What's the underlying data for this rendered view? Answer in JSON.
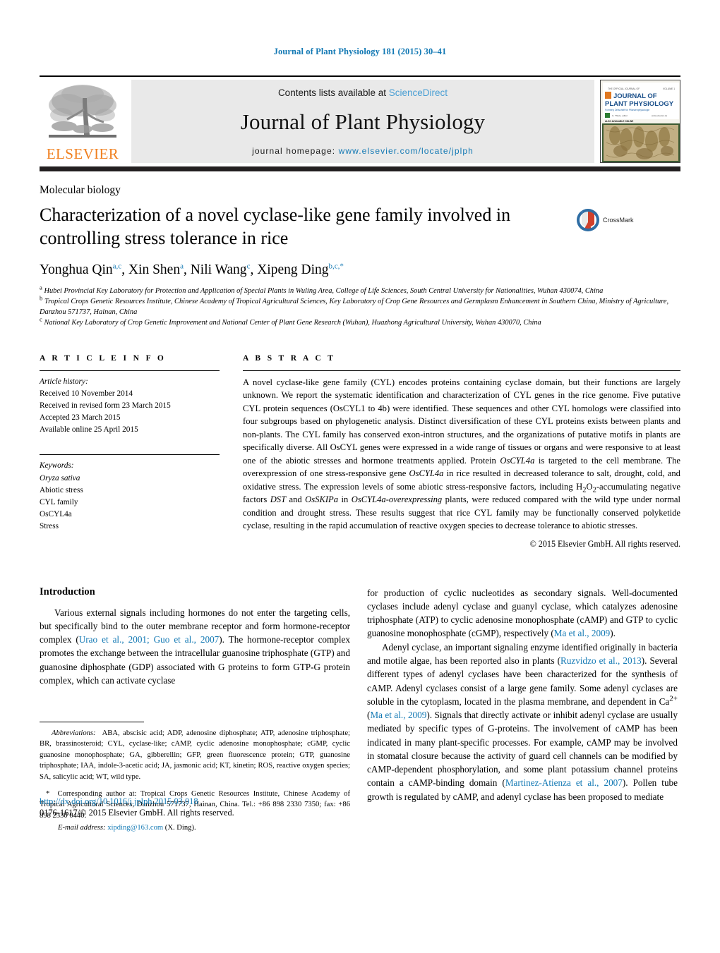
{
  "running_head": "Journal of Plant Physiology 181 (2015) 30–41",
  "masthead": {
    "publisher_name": "ELSEVIER",
    "contents_prefix": "Contents lists available at ",
    "contents_link": "ScienceDirect",
    "journal_title": "Journal of Plant Physiology",
    "homepage_prefix": "journal homepage: ",
    "homepage_url": "www.elsevier.com/locate/jplph",
    "cover": {
      "line1": "JOURNAL OF",
      "line2": "PLANT PHYSIOLOGY"
    },
    "link_color": "#1379b4",
    "sciencedirect_color": "#4a9fd4",
    "elsevier_orange": "#f08020"
  },
  "article": {
    "section_label": "Molecular biology",
    "title": "Characterization of a novel cyclase-like gene family involved in controlling stress tolerance in rice",
    "crossmark_label": "CrossMark",
    "authors_html": "Yonghua Qin<sup>a,c</sup>, Xin Shen<sup>a</sup>, Nili Wang<sup>c</sup>, Xipeng Ding<sup>b,c,</sup><sup>*</sup>",
    "affiliations": [
      "Hubei Provincial Key Laboratory for Protection and Application of Special Plants in Wuling Area, College of Life Sciences, South Central University for Nationalities, Wuhan 430074, China",
      "Tropical Crops Genetic Resources Institute, Chinese Academy of Tropical Agricultural Sciences, Key Laboratory of Crop Gene Resources and Germplasm Enhancement in Southern China, Ministry of Agriculture, Danzhou 571737, Hainan, China",
      "National Key Laboratory of Crop Genetic Improvement and National Center of Plant Gene Research (Wuhan), Huazhong Agricultural University, Wuhan 430070, China"
    ],
    "affiliation_markers": [
      "a",
      "b",
      "c"
    ]
  },
  "article_info": {
    "heading": "A R T I C L E    I N F O",
    "history_label": "Article history:",
    "history": [
      "Received 10 November 2014",
      "Received in revised form 23 March 2015",
      "Accepted 23 March 2015",
      "Available online 25 April 2015"
    ],
    "keywords_label": "Keywords:",
    "keywords": [
      "Oryza sativa",
      "Abiotic stress",
      "CYL family",
      "OsCYL4a",
      "Stress"
    ],
    "keyword_italic_flags": [
      true,
      false,
      false,
      false,
      false
    ]
  },
  "abstract": {
    "heading": "A B S T R A C T",
    "text": "A novel cyclase-like gene family (CYL) encodes proteins containing cyclase domain, but their functions are largely unknown. We report the systematic identification and characterization of CYL genes in the rice genome. Five putative CYL protein sequences (OsCYL1 to 4b) were identified. These sequences and other CYL homologs were classified into four subgroups based on phylogenetic analysis. Distinct diversification of these CYL proteins exists between plants and non-plants. The CYL family has conserved exon-intron structures, and the organizations of putative motifs in plants are specifically diverse. All OsCYL genes were expressed in a wide range of tissues or organs and were responsive to at least one of the abiotic stresses and hormone treatments applied. Protein OsCYL4a is targeted to the cell membrane. The overexpression of one stress-responsive gene OsCYL4a in rice resulted in decreased tolerance to salt, drought, cold, and oxidative stress. The expression levels of some abiotic stress-responsive factors, including H2O2-accumulating negative factors DST and OsSKIPa in OsCYL4a-overexpressing plants, were reduced compared with the wild type under normal condition and drought stress. These results suggest that rice CYL family may be functionally conserved polyketide cyclase, resulting in the rapid accumulation of reactive oxygen species to decrease tolerance to abiotic stresses.",
    "copyright": "© 2015 Elsevier GmbH. All rights reserved."
  },
  "body": {
    "intro_heading": "Introduction",
    "left_paragraph_1_pre": "Various external signals including hormones do not enter the targeting cells, but specifically bind to the outer membrane receptor and form hormone-receptor complex (",
    "left_paragraph_1_ref": "Urao et al., 2001; Guo et al., 2007",
    "left_paragraph_1_post": "). The hormone-receptor complex promotes the exchange between the intracellular guanosine triphosphate (GTP) and guanosine diphosphate (GDP) associated with G proteins to form GTP-G protein complex, which can activate cyclase",
    "right_paragraph_1_pre": "for production of cyclic nucleotides as secondary signals. Well-documented cyclases include adenyl cyclase and guanyl cyclase, which catalyzes adenosine triphosphate (ATP) to cyclic adenosine monophosphate (cAMP) and GTP to cyclic guanosine monophosphate (cGMP), respectively (",
    "right_paragraph_1_ref": "Ma et al., 2009",
    "right_paragraph_1_post": ").",
    "right_paragraph_2_seg1": "Adenyl cyclase, an important signaling enzyme identified originally in bacteria and motile algae, has been reported also in plants (",
    "right_paragraph_2_ref1": "Ruzvidzo et al., 2013",
    "right_paragraph_2_seg2": "). Several different types of adenyl cyclases have been characterized for the synthesis of cAMP. Adenyl cyclases consist of a large gene family. Some adenyl cyclases are soluble in the cytoplasm, located in the plasma membrane, and dependent in Ca2+ (",
    "right_paragraph_2_ref2": "Ma et al., 2009",
    "right_paragraph_2_seg3": "). Signals that directly activate or inhibit adenyl cyclase are usually mediated by specific types of G-proteins. The involvement of cAMP has been indicated in many plant-specific processes. For example, cAMP may be involved in stomatal closure because the activity of guard cell channels can be modified by cAMP-dependent phosphorylation, and some plant potassium channel proteins contain a cAMP-binding domain (",
    "right_paragraph_2_ref3": "Martinez-Atienza et al., 2007",
    "right_paragraph_2_seg4": "). Pollen tube growth is regulated by cAMP, and adenyl cyclase has been proposed to mediate"
  },
  "footnotes": {
    "abbrev_label": "Abbreviations:",
    "abbrev_text": "ABA, abscisic acid; ADP, adenosine diphosphate; ATP, adenosine triphosphate; BR, brassinosteroid; CYL, cyclase-like; cAMP, cyclic adenosine monophosphate; cGMP, cyclic guanosine monophosphate; GA, gibberellin; GFP, green fluorescence protein; GTP, guanosine triphosphate; IAA, indole-3-acetic acid; JA, jasmonic acid; KT, kinetin; ROS, reactive oxygen species; SA, salicylic acid; WT, wild type.",
    "corresponding_marker": "*",
    "corresponding_text": "Corresponding author at: Tropical Crops Genetic Resources Institute, Chinese Academy of Tropical Agricultural Sciences, Danzhou 571737, Hainan, China. Tel.: +86 898 2330 7350; fax: +86 898 2330 0440.",
    "email_label": "E-mail address:",
    "email_address": "xipding@163.com",
    "email_suffix": "(X. Ding)."
  },
  "footer": {
    "doi": "http://dx.doi.org/10.1016/j.jplph.2015.03.018",
    "issn_line": "0176-1617/© 2015 Elsevier GmbH. All rights reserved."
  }
}
